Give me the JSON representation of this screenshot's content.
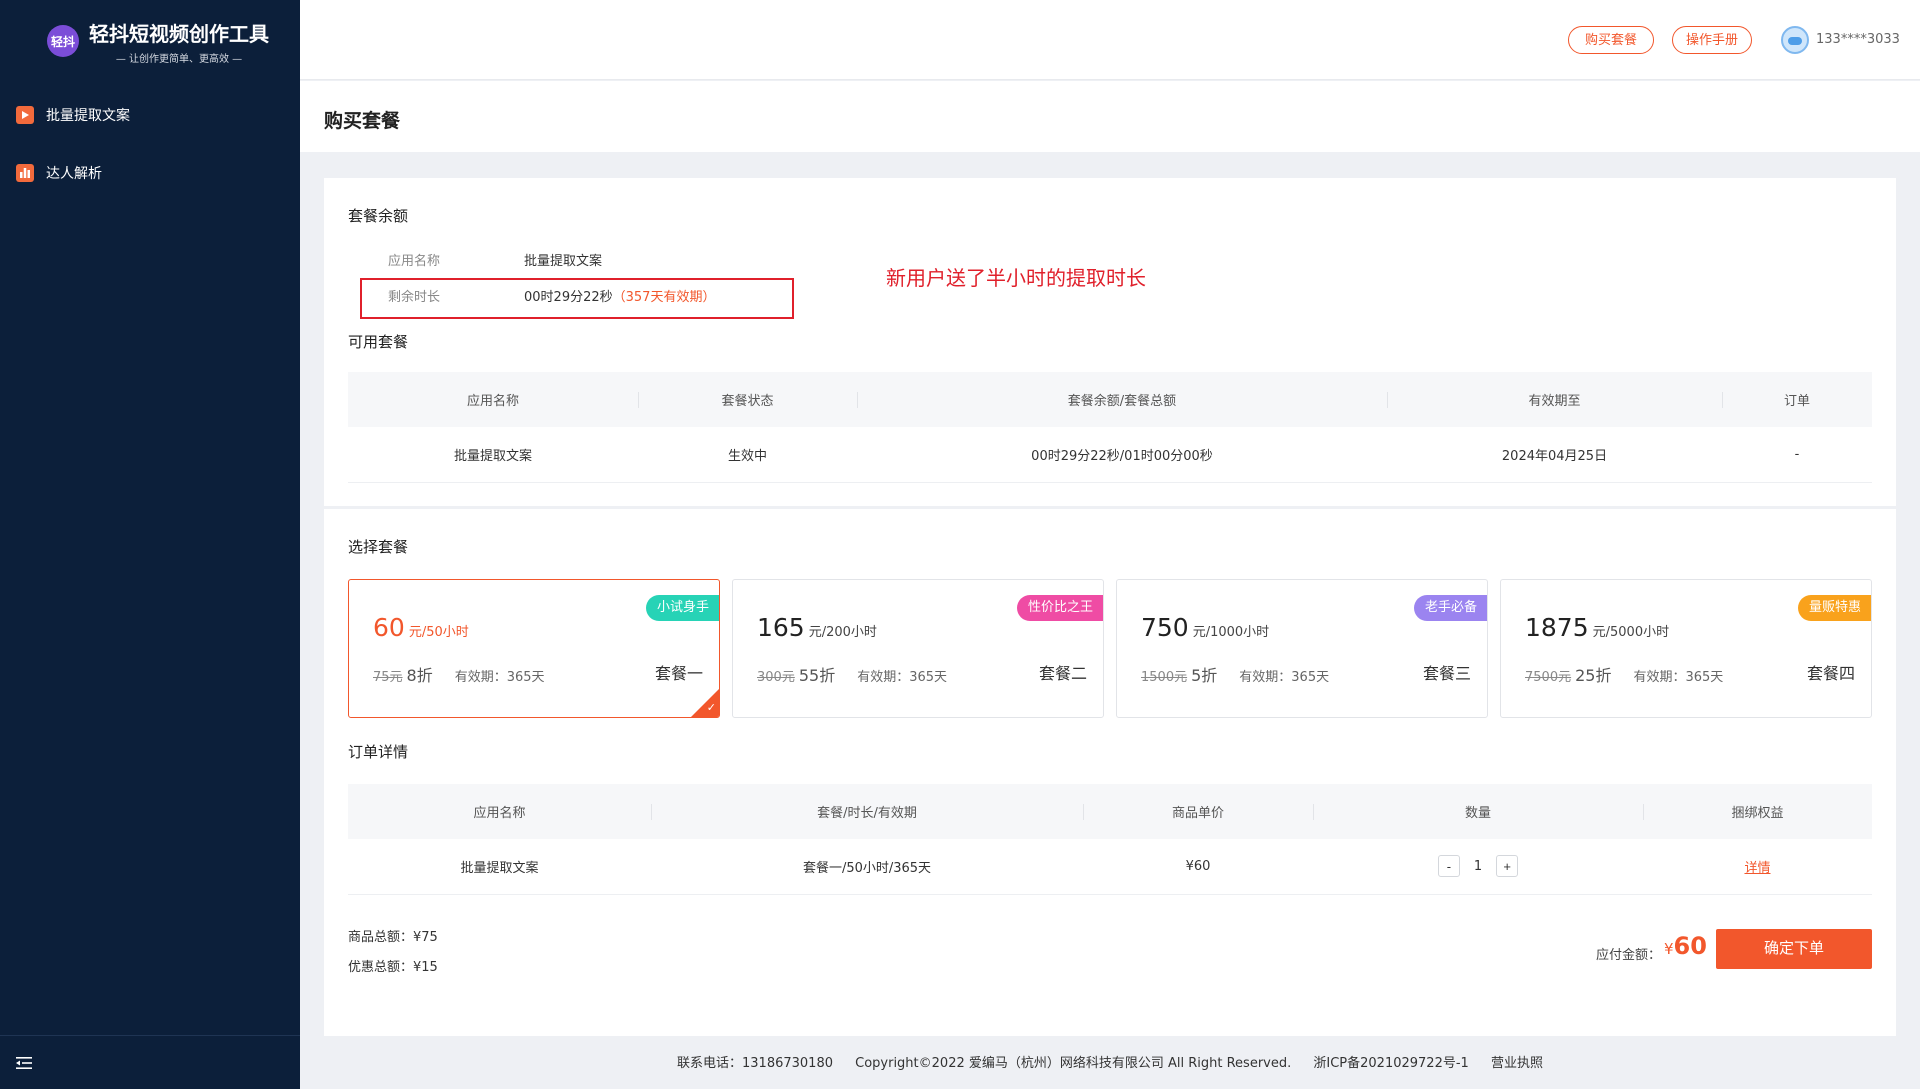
{
  "brand": {
    "logo_text": "轻抖",
    "title": "轻抖短视频创作工具",
    "subtitle": "— 让创作更简单、更高效 —"
  },
  "sidebar": {
    "items": [
      {
        "label": "批量提取文案",
        "icon": "video-icon"
      },
      {
        "label": "达人解析",
        "icon": "bar-chart-icon"
      }
    ]
  },
  "header": {
    "buy_label": "购买套餐",
    "manual_label": "操作手册",
    "username": "133****3033"
  },
  "page": {
    "title": "购买套餐"
  },
  "balance": {
    "title": "套餐余额",
    "app_label": "应用名称",
    "app_value": "批量提取文案",
    "remain_label": "剩余时长",
    "remain_value": "00时29分22秒",
    "remain_validity": "（357天有效期）"
  },
  "annotation": "新用户送了半小时的提取时长",
  "available": {
    "title": "可用套餐",
    "headers": [
      "应用名称",
      "套餐状态",
      "套餐余额/套餐总额",
      "有效期至",
      "订单"
    ],
    "rows": [
      [
        "批量提取文案",
        "生效中",
        "00时29分22秒/01时00分00秒",
        "2024年04月25日",
        "-"
      ]
    ]
  },
  "choose": {
    "title": "选择套餐",
    "packages": [
      {
        "price": "60",
        "unit": "元/50小时",
        "original": "75元",
        "discount": "8折",
        "validity": "有效期：365天",
        "name": "套餐一",
        "tag": "小试身手",
        "tag_color": "#27d3b6",
        "selected": true
      },
      {
        "price": "165",
        "unit": "元/200小时",
        "original": "300元",
        "discount": "55折",
        "validity": "有效期：365天",
        "name": "套餐二",
        "tag": "性价比之王",
        "tag_color": "#ef4ca4",
        "selected": false
      },
      {
        "price": "750",
        "unit": "元/1000小时",
        "original": "1500元",
        "discount": "5折",
        "validity": "有效期：365天",
        "name": "套餐三",
        "tag": "老手必备",
        "tag_color": "#9b84f0",
        "selected": false
      },
      {
        "price": "1875",
        "unit": "元/5000小时",
        "original": "7500元",
        "discount": "25折",
        "validity": "有效期：365天",
        "name": "套餐四",
        "tag": "量贩特惠",
        "tag_color": "#f9a21c",
        "selected": false
      }
    ]
  },
  "order": {
    "title": "订单详情",
    "headers": [
      "应用名称",
      "套餐/时长/有效期",
      "商品单价",
      "数量",
      "捆绑权益"
    ],
    "row": {
      "app": "批量提取文案",
      "package": "套餐一/50小时/365天",
      "price": "¥60",
      "qty": "1",
      "minus": "-",
      "plus": "+",
      "benefit": "详情"
    }
  },
  "summary": {
    "total_label": "商品总额：¥75",
    "discount_label": "优惠总额：¥15",
    "pay_label": "应付金额：",
    "pay_currency": "¥",
    "pay_amount": "60",
    "submit_label": "确定下单"
  },
  "footer": {
    "phone": "联系电话：13186730180",
    "copyright": "Copyright©2022 爱编马（杭州）网络科技有限公司 All Right Reserved.",
    "icp": "浙ICP备2021029722号-1",
    "license": "营业执照"
  },
  "colors": {
    "accent": "#f2572c",
    "sidebar_bg": "#0c1f3a",
    "annotation": "#e0202b"
  }
}
